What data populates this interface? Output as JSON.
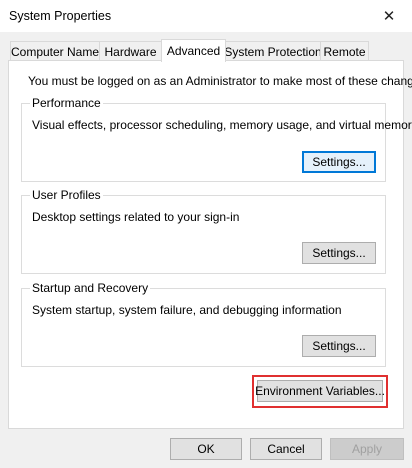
{
  "window": {
    "title": "System Properties",
    "close_glyph": "✕"
  },
  "tabs": [
    {
      "label": "Computer Name"
    },
    {
      "label": "Hardware"
    },
    {
      "label": "Advanced",
      "active": true
    },
    {
      "label": "System Protection"
    },
    {
      "label": "Remote"
    }
  ],
  "advanced": {
    "notice": "You must be logged on as an Administrator to make most of these changes.",
    "performance": {
      "label": "Performance",
      "description": "Visual effects, processor scheduling, memory usage, and virtual memory",
      "button": "Settings..."
    },
    "user_profiles": {
      "label": "User Profiles",
      "description": "Desktop settings related to your sign-in",
      "button": "Settings..."
    },
    "startup_recovery": {
      "label": "Startup and Recovery",
      "description": "System startup, system failure, and debugging information",
      "button": "Settings..."
    },
    "env_button": "Environment Variables..."
  },
  "footer": {
    "ok": "OK",
    "cancel": "Cancel",
    "apply": "Apply"
  },
  "colors": {
    "highlight": "#e03030",
    "focus_border": "#0078d7"
  },
  "icons": {
    "close": "close-icon"
  }
}
